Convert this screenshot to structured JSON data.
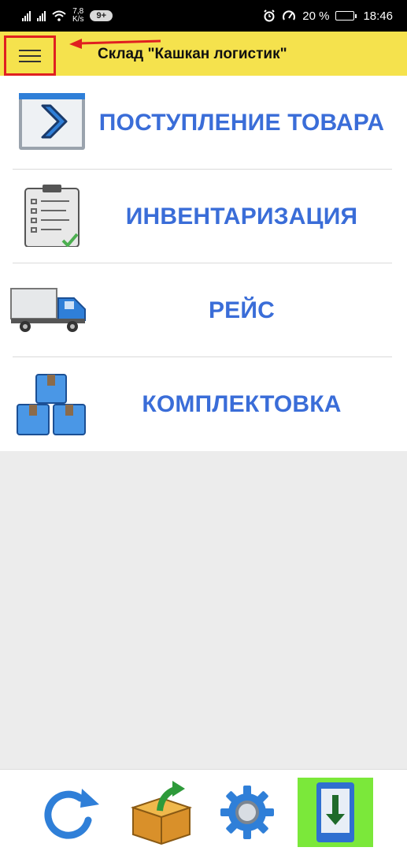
{
  "status_bar": {
    "speed_value": "7,8",
    "speed_unit": "K/s",
    "badge": "9+",
    "battery": "20 %",
    "battery_level": 0.2,
    "time": "18:46"
  },
  "toolbar": {
    "title": "Склад \"Кашкан логистик\""
  },
  "menu": [
    {
      "label": "ПОСТУПЛЕНИЕ ТОВАРА",
      "icon": "arrow-right-window-icon"
    },
    {
      "label": "ИНВЕНТАРИЗАЦИЯ",
      "icon": "clipboard-checklist-icon"
    },
    {
      "label": "РЕЙС",
      "icon": "truck-icon"
    },
    {
      "label": "КОМПЛЕКТОВКА",
      "icon": "stacked-boxes-icon"
    }
  ],
  "bottom_bar": [
    {
      "icon": "refresh-icon"
    },
    {
      "icon": "box-import-icon"
    },
    {
      "icon": "gear-icon"
    },
    {
      "icon": "download-phone-icon"
    }
  ],
  "colors": {
    "toolbar": "#f5e24d",
    "label": "#3a6dd8",
    "highlight": "#e02020",
    "download_button": "#7be83a"
  }
}
